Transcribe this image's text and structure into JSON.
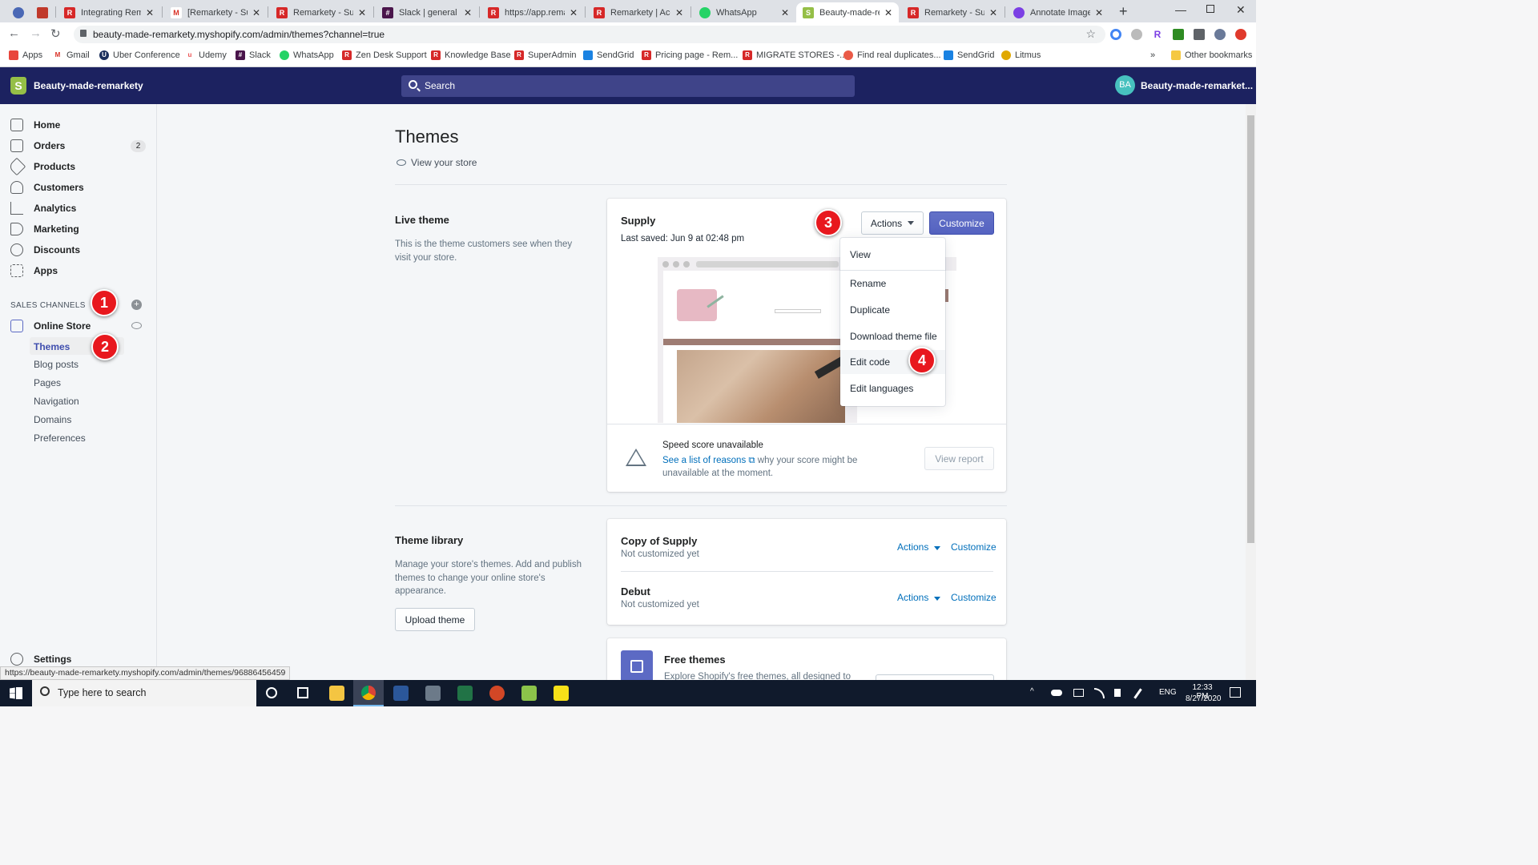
{
  "browser": {
    "tabs": [
      {
        "title": "",
        "color": "#4a68b5",
        "letter": "c"
      },
      {
        "title": "",
        "color": "#c0392b",
        "letter": "▲"
      },
      {
        "title": "Integrating Remar",
        "color": "#d62828",
        "letter": "R"
      },
      {
        "title": "[Remarkety - Supp",
        "color": "#ffffff",
        "letter": "M"
      },
      {
        "title": "Remarkety - Supp",
        "color": "#d62828",
        "letter": "R"
      },
      {
        "title": "Slack | general | Re",
        "color": "#4a154b",
        "letter": "#"
      },
      {
        "title": "https://app.remark",
        "color": "#d62828",
        "letter": "R"
      },
      {
        "title": "Remarkety | Accou",
        "color": "#d62828",
        "letter": "R"
      },
      {
        "title": "WhatsApp",
        "color": "#25d366",
        "letter": "W"
      },
      {
        "title": "Beauty-made-rem",
        "color": "#95bf47",
        "letter": "S"
      },
      {
        "title": "Remarkety - Supp",
        "color": "#d62828",
        "letter": "R"
      },
      {
        "title": "Annotate Image",
        "color": "#7b3fe4",
        "letter": "◎"
      }
    ],
    "url": "beauty-made-remarkety.myshopify.com/admin/themes?channel=true",
    "bookmarks": [
      {
        "label": "Apps",
        "color": "#e8453c"
      },
      {
        "label": "Gmail",
        "color": "#d93025"
      },
      {
        "label": "Uber Conference",
        "color": "#1b2f5c"
      },
      {
        "label": "Udemy",
        "color": "#ec5252"
      },
      {
        "label": "Slack",
        "color": "#4a154b"
      },
      {
        "label": "WhatsApp",
        "color": "#25d366"
      },
      {
        "label": "Zen Desk Support",
        "color": "#d62828"
      },
      {
        "label": "Knowledge Base",
        "color": "#d62828"
      },
      {
        "label": "SuperAdmin",
        "color": "#d62828"
      },
      {
        "label": "SendGrid",
        "color": "#1a82e2"
      },
      {
        "label": "Pricing page - Rem...",
        "color": "#d62828"
      },
      {
        "label": "MIGRATE STORES -...",
        "color": "#d62828"
      },
      {
        "label": "Find real duplicates...",
        "color": "#ea5a47"
      },
      {
        "label": "SendGrid",
        "color": "#1a82e2"
      },
      {
        "label": "Litmus",
        "color": "#e0a800"
      }
    ],
    "bookmarks_more": "»",
    "other_bookmarks": "Other bookmarks"
  },
  "topbar": {
    "store_name": "Beauty-made-remarkety",
    "search_placeholder": "Search",
    "avatar_initials": "BA",
    "account_name": "Beauty-made-remarket..."
  },
  "sidebar": {
    "items": [
      {
        "label": "Home",
        "icon": "home-icon"
      },
      {
        "label": "Orders",
        "icon": "orders-icon",
        "badge": "2"
      },
      {
        "label": "Products",
        "icon": "tag-icon"
      },
      {
        "label": "Customers",
        "icon": "person-icon"
      },
      {
        "label": "Analytics",
        "icon": "bar-chart-icon"
      },
      {
        "label": "Marketing",
        "icon": "megaphone-icon"
      },
      {
        "label": "Discounts",
        "icon": "discount-icon"
      },
      {
        "label": "Apps",
        "icon": "apps-icon"
      }
    ],
    "sales_channels_label": "SALES CHANNELS",
    "online_store": "Online Store",
    "sub_items": [
      "Themes",
      "Blog posts",
      "Pages",
      "Navigation",
      "Domains",
      "Preferences"
    ],
    "settings": "Settings"
  },
  "main": {
    "title": "Themes",
    "view_store": "View your store",
    "live_theme": {
      "heading": "Live theme",
      "description": "This is the theme customers see when they visit your store.",
      "theme_name": "Supply",
      "last_saved": "Last saved: Jun 9 at 02:48 pm",
      "actions_label": "Actions",
      "customize_label": "Customize",
      "dropdown": [
        "View",
        "Rename",
        "Duplicate",
        "Download theme file",
        "Edit code",
        "Edit languages"
      ],
      "speed_title": "Speed score unavailable",
      "speed_link": "See a list of reasons",
      "speed_rest": " why your score might be unavailable at the moment.",
      "view_report": "View report"
    },
    "library": {
      "heading": "Theme library",
      "description": "Manage your store's themes. Add and publish themes to change your online store's appearance.",
      "upload_label": "Upload theme",
      "themes": [
        {
          "name": "Copy of Supply",
          "status": "Not customized yet",
          "actions": "Actions",
          "customize": "Customize"
        },
        {
          "name": "Debut",
          "status": "Not customized yet",
          "actions": "Actions",
          "customize": "Customize"
        }
      ],
      "free_themes_title": "Free themes",
      "free_themes_desc": "Explore Shopify's free themes, all designed to"
    }
  },
  "annotations": [
    "1",
    "2",
    "3",
    "4"
  ],
  "status_url": "https://beauty-made-remarkety.myshopify.com/admin/themes/96886456459",
  "taskbar": {
    "search_placeholder": "Type here to search",
    "language": "ENG",
    "time": "12:33 PM",
    "date": "8/27/2020"
  },
  "colors": {
    "topbar": "#1c2260",
    "primary_button": "#5c6ac4",
    "link": "#006fbb",
    "marker": "#e8181e"
  }
}
